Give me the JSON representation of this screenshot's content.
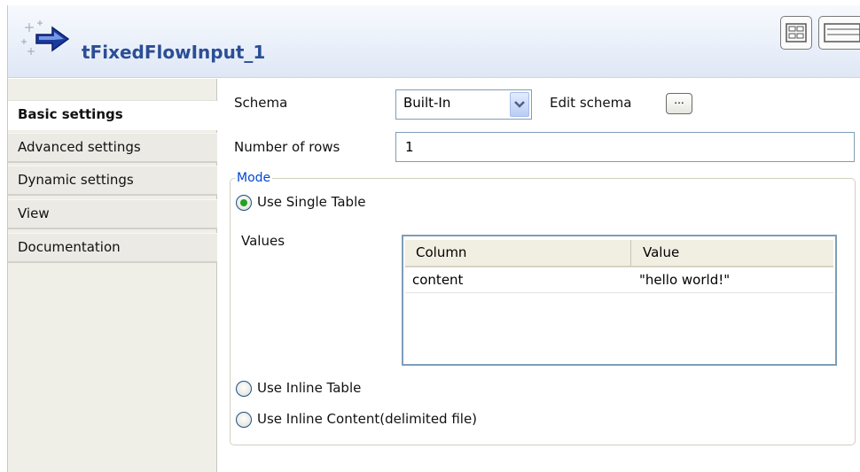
{
  "header": {
    "title": "tFixedFlowInput_1",
    "icon": "component-arrow-icon",
    "title_color": "#2b4e95"
  },
  "sidebar": {
    "items": [
      {
        "label": "Basic settings",
        "active": true
      },
      {
        "label": "Advanced settings",
        "active": false
      },
      {
        "label": "Dynamic settings",
        "active": false
      },
      {
        "label": "View",
        "active": false
      },
      {
        "label": "Documentation",
        "active": false
      }
    ]
  },
  "settings": {
    "schema_label": "Schema",
    "schema_value": "Built-In",
    "edit_schema_label": "Edit schema",
    "edit_schema_button": "...",
    "rows_label": "Number of rows",
    "rows_value": "1"
  },
  "mode": {
    "legend": "Mode",
    "options": [
      {
        "label": "Use Single Table",
        "checked": true
      },
      {
        "label": "Use Inline Table",
        "checked": false
      },
      {
        "label": "Use Inline Content(delimited file)",
        "checked": false
      }
    ],
    "values_label": "Values",
    "table": {
      "columns": [
        "Column",
        "Value"
      ],
      "rows": [
        [
          "content",
          "\"hello world!\""
        ]
      ]
    }
  }
}
